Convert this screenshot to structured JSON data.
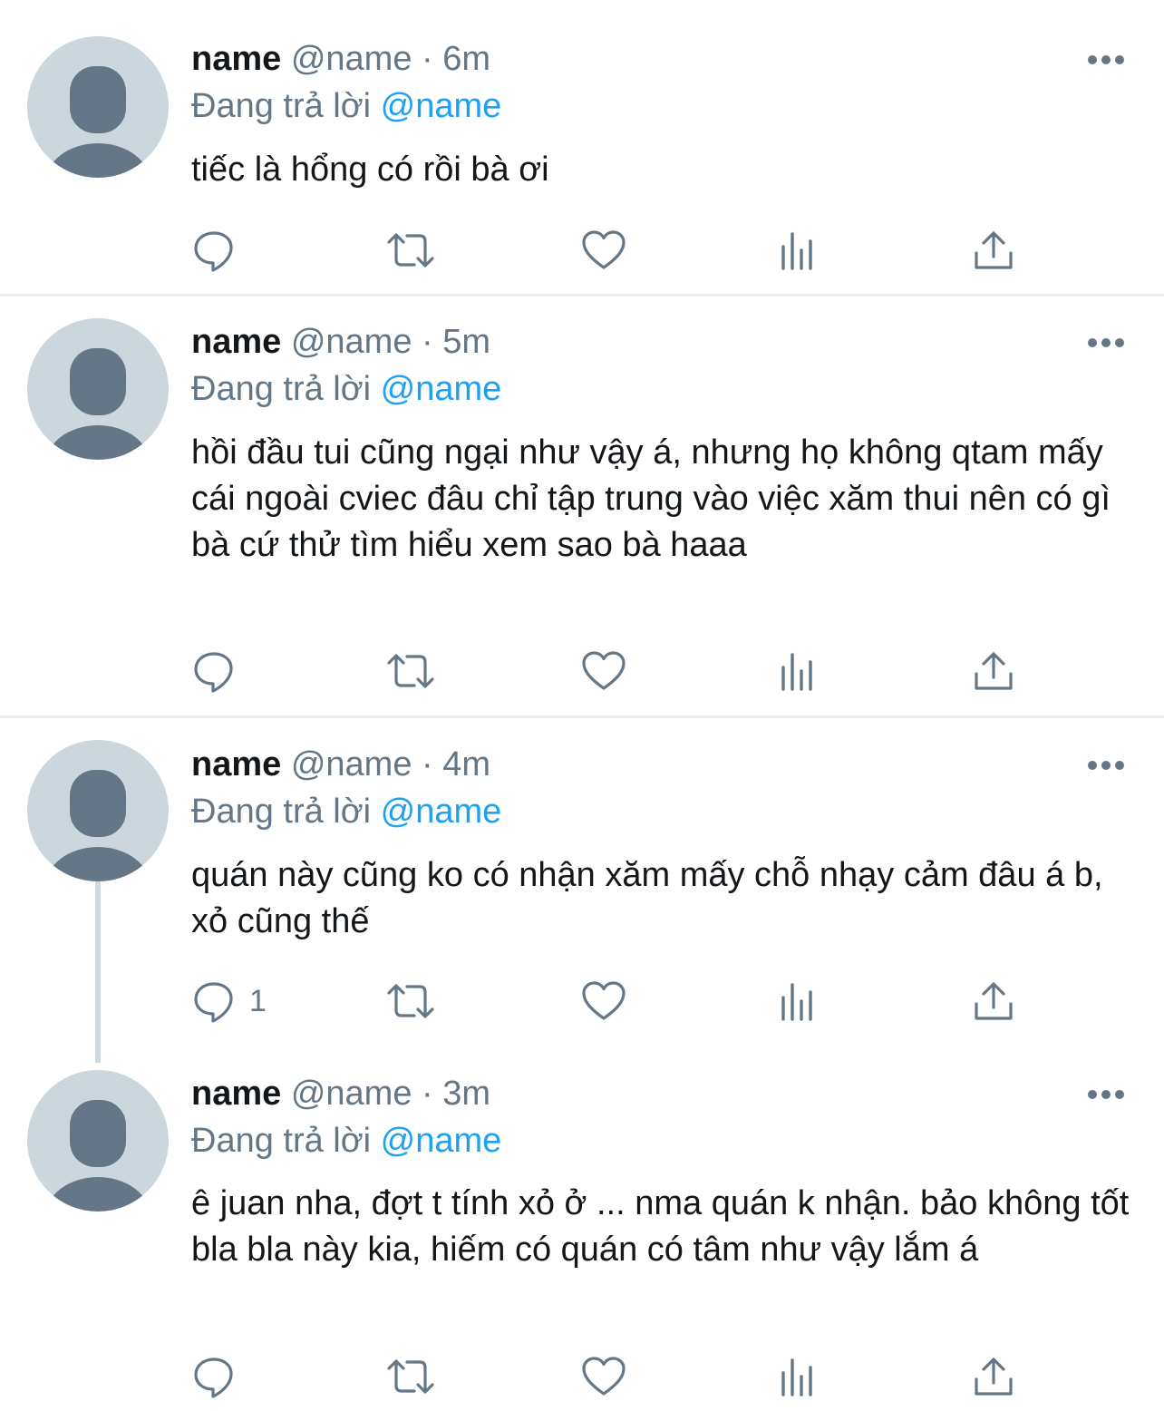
{
  "tweets": [
    {
      "name": "name",
      "handle": "@name",
      "separator": "·",
      "time": "6m",
      "reply_prefix": "Đang trả lời",
      "reply_to": "@name",
      "text": "tiếc là hổng có rồi bà ơi",
      "reply_count": ""
    },
    {
      "name": "name",
      "handle": "@name",
      "separator": "·",
      "time": "5m",
      "reply_prefix": "Đang trả lời",
      "reply_to": "@name",
      "text": "hồi đầu tui cũng ngại như vậy á, nhưng họ không qtam mấy cái ngoài cviec đâu chỉ tập trung vào việc xăm thui nên có gì bà cứ thử tìm hiểu xem sao bà haaa",
      "reply_count": ""
    },
    {
      "name": "name",
      "handle": "@name",
      "separator": "·",
      "time": "4m",
      "reply_prefix": "Đang trả lời",
      "reply_to": "@name",
      "text": "quán này cũng ko có nhận xăm mấy chỗ nhạy cảm đâu á b, xỏ cũng thế",
      "reply_count": "1"
    },
    {
      "name": "name",
      "handle": "@name",
      "separator": "·",
      "time": "3m",
      "reply_prefix": "Đang trả lời",
      "reply_to": "@name",
      "text": "ê juan nha, đợt t tính xỏ ở ... nma quán k nhận. bảo không tốt bla bla này kia, hiếm có quán có tâm như vậy lắm á",
      "reply_count": ""
    }
  ],
  "colors": {
    "accent": "#1da1f2",
    "secondary_text": "#657786",
    "primary_text": "#14171a",
    "avatar_bg": "#ccd6dd",
    "avatar_silhouette": "#657786",
    "divider": "#e6ecf0"
  },
  "icons": {
    "reply": "reply-icon",
    "retweet": "retweet-icon",
    "like": "heart-icon",
    "analytics": "analytics-icon",
    "share": "share-icon",
    "more": "more-icon"
  }
}
